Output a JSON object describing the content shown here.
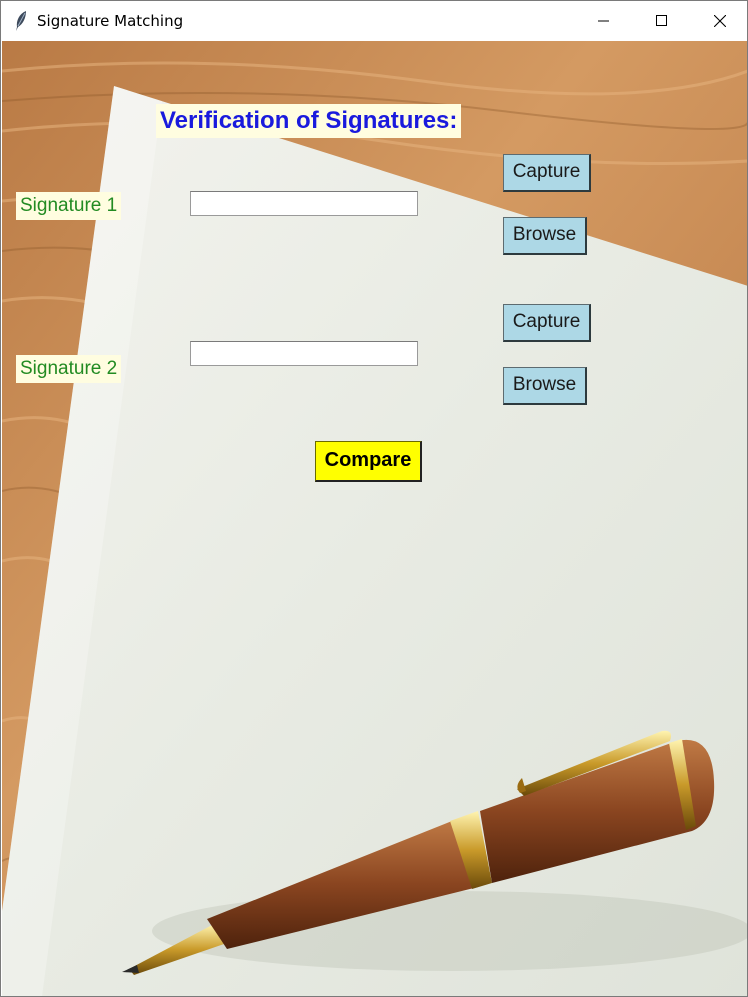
{
  "window": {
    "title": "Signature Matching",
    "controls": {
      "minimize": "minimize-icon",
      "maximize": "maximize-icon",
      "close": "close-icon"
    }
  },
  "form": {
    "heading": "Verification of Signatures:",
    "signature1": {
      "label": "Signature 1",
      "value": "",
      "capture_label": "Capture",
      "browse_label": "Browse"
    },
    "signature2": {
      "label": "Signature 2",
      "value": "",
      "capture_label": "Capture",
      "browse_label": "Browse"
    },
    "compare_label": "Compare"
  },
  "colors": {
    "heading": "#1a1add",
    "label_text": "#228b22",
    "label_bg": "#fffde0",
    "button_bg": "#add8e6",
    "compare_bg": "#ffff00"
  }
}
